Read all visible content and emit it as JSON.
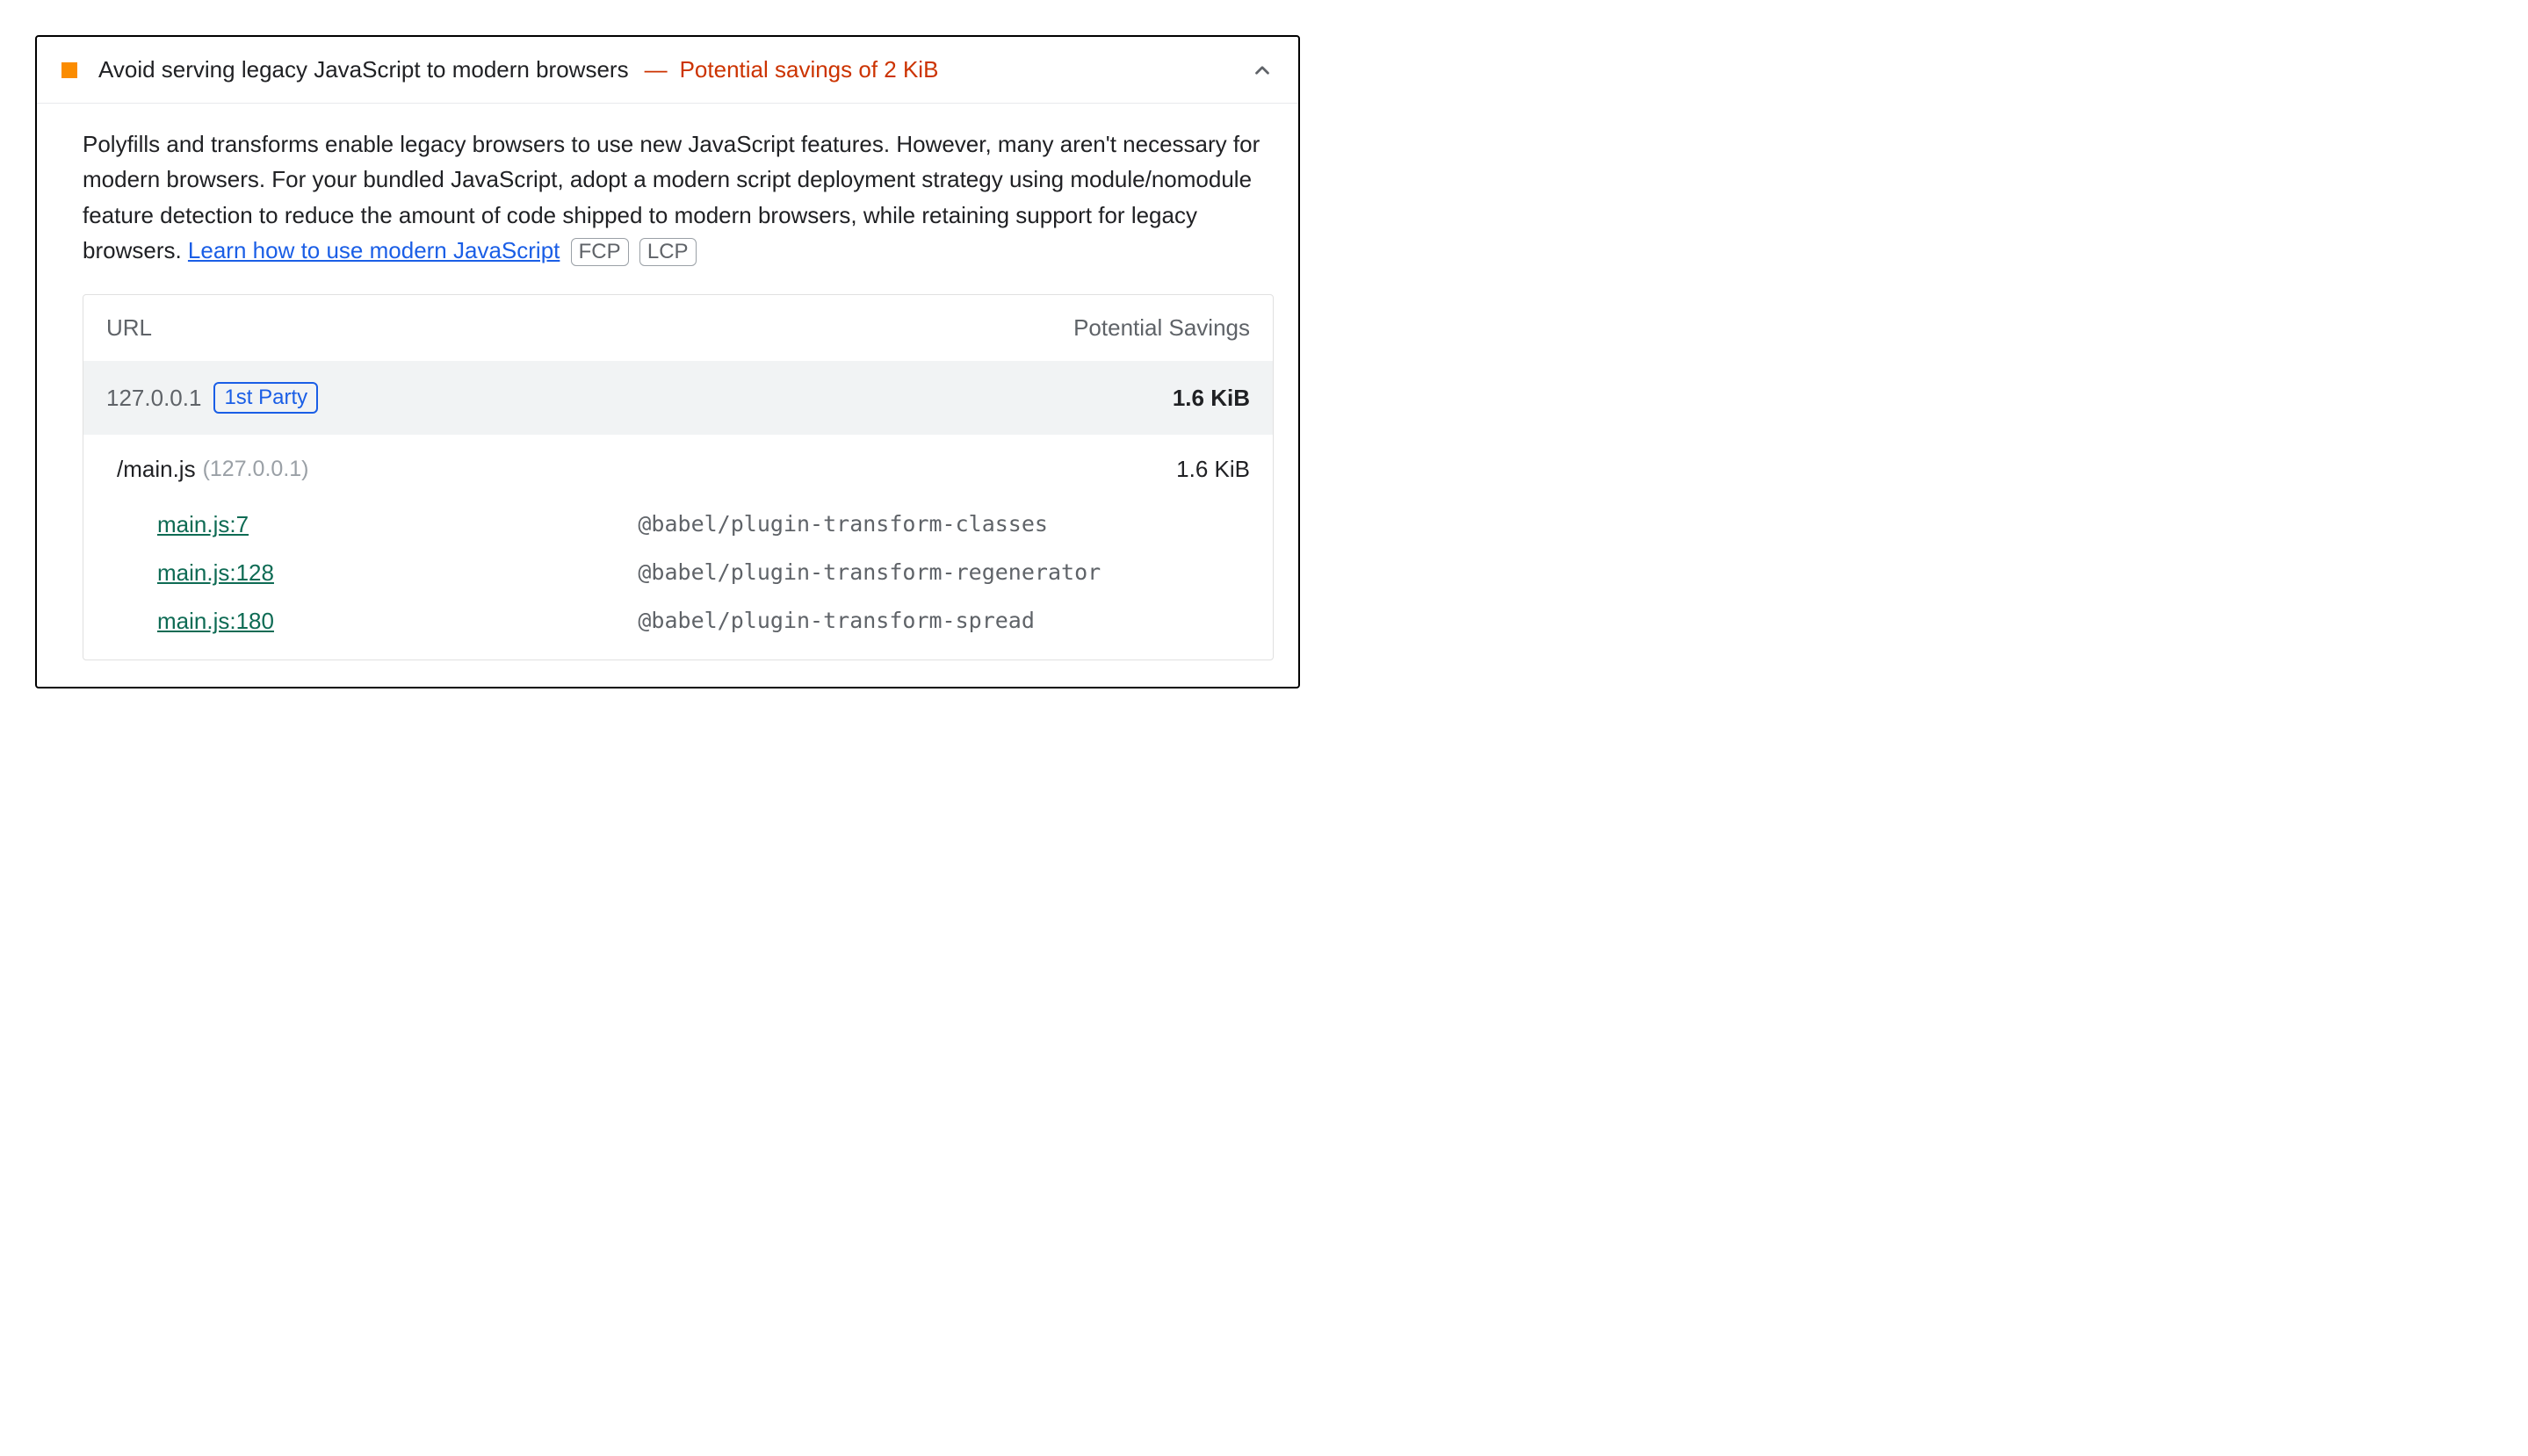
{
  "audit": {
    "title": "Avoid serving legacy JavaScript to modern browsers",
    "separator": "—",
    "savings_summary": "Potential savings of 2 KiB",
    "description_text": "Polyfills and transforms enable legacy browsers to use new JavaScript features. However, many aren't necessary for modern browsers. For your bundled JavaScript, adopt a modern script deployment strategy using module/nomodule feature detection to reduce the amount of code shipped to modern browsers, while retaining support for legacy browsers. ",
    "learn_link_text": "Learn how to use modern JavaScript",
    "metric_badges": {
      "fcp": "FCP",
      "lcp": "LCP"
    },
    "table": {
      "headers": {
        "url": "URL",
        "savings": "Potential Savings"
      },
      "origin": {
        "host": "127.0.0.1",
        "party_badge": "1st Party",
        "savings": "1.6 KiB"
      },
      "file": {
        "path": "/main.js",
        "host_text": "(127.0.0.1)",
        "savings": "1.6 KiB"
      },
      "transforms": [
        {
          "source": "main.js:7",
          "plugin": "@babel/plugin-transform-classes"
        },
        {
          "source": "main.js:128",
          "plugin": "@babel/plugin-transform-regenerator"
        },
        {
          "source": "main.js:180",
          "plugin": "@babel/plugin-transform-spread"
        }
      ]
    }
  }
}
